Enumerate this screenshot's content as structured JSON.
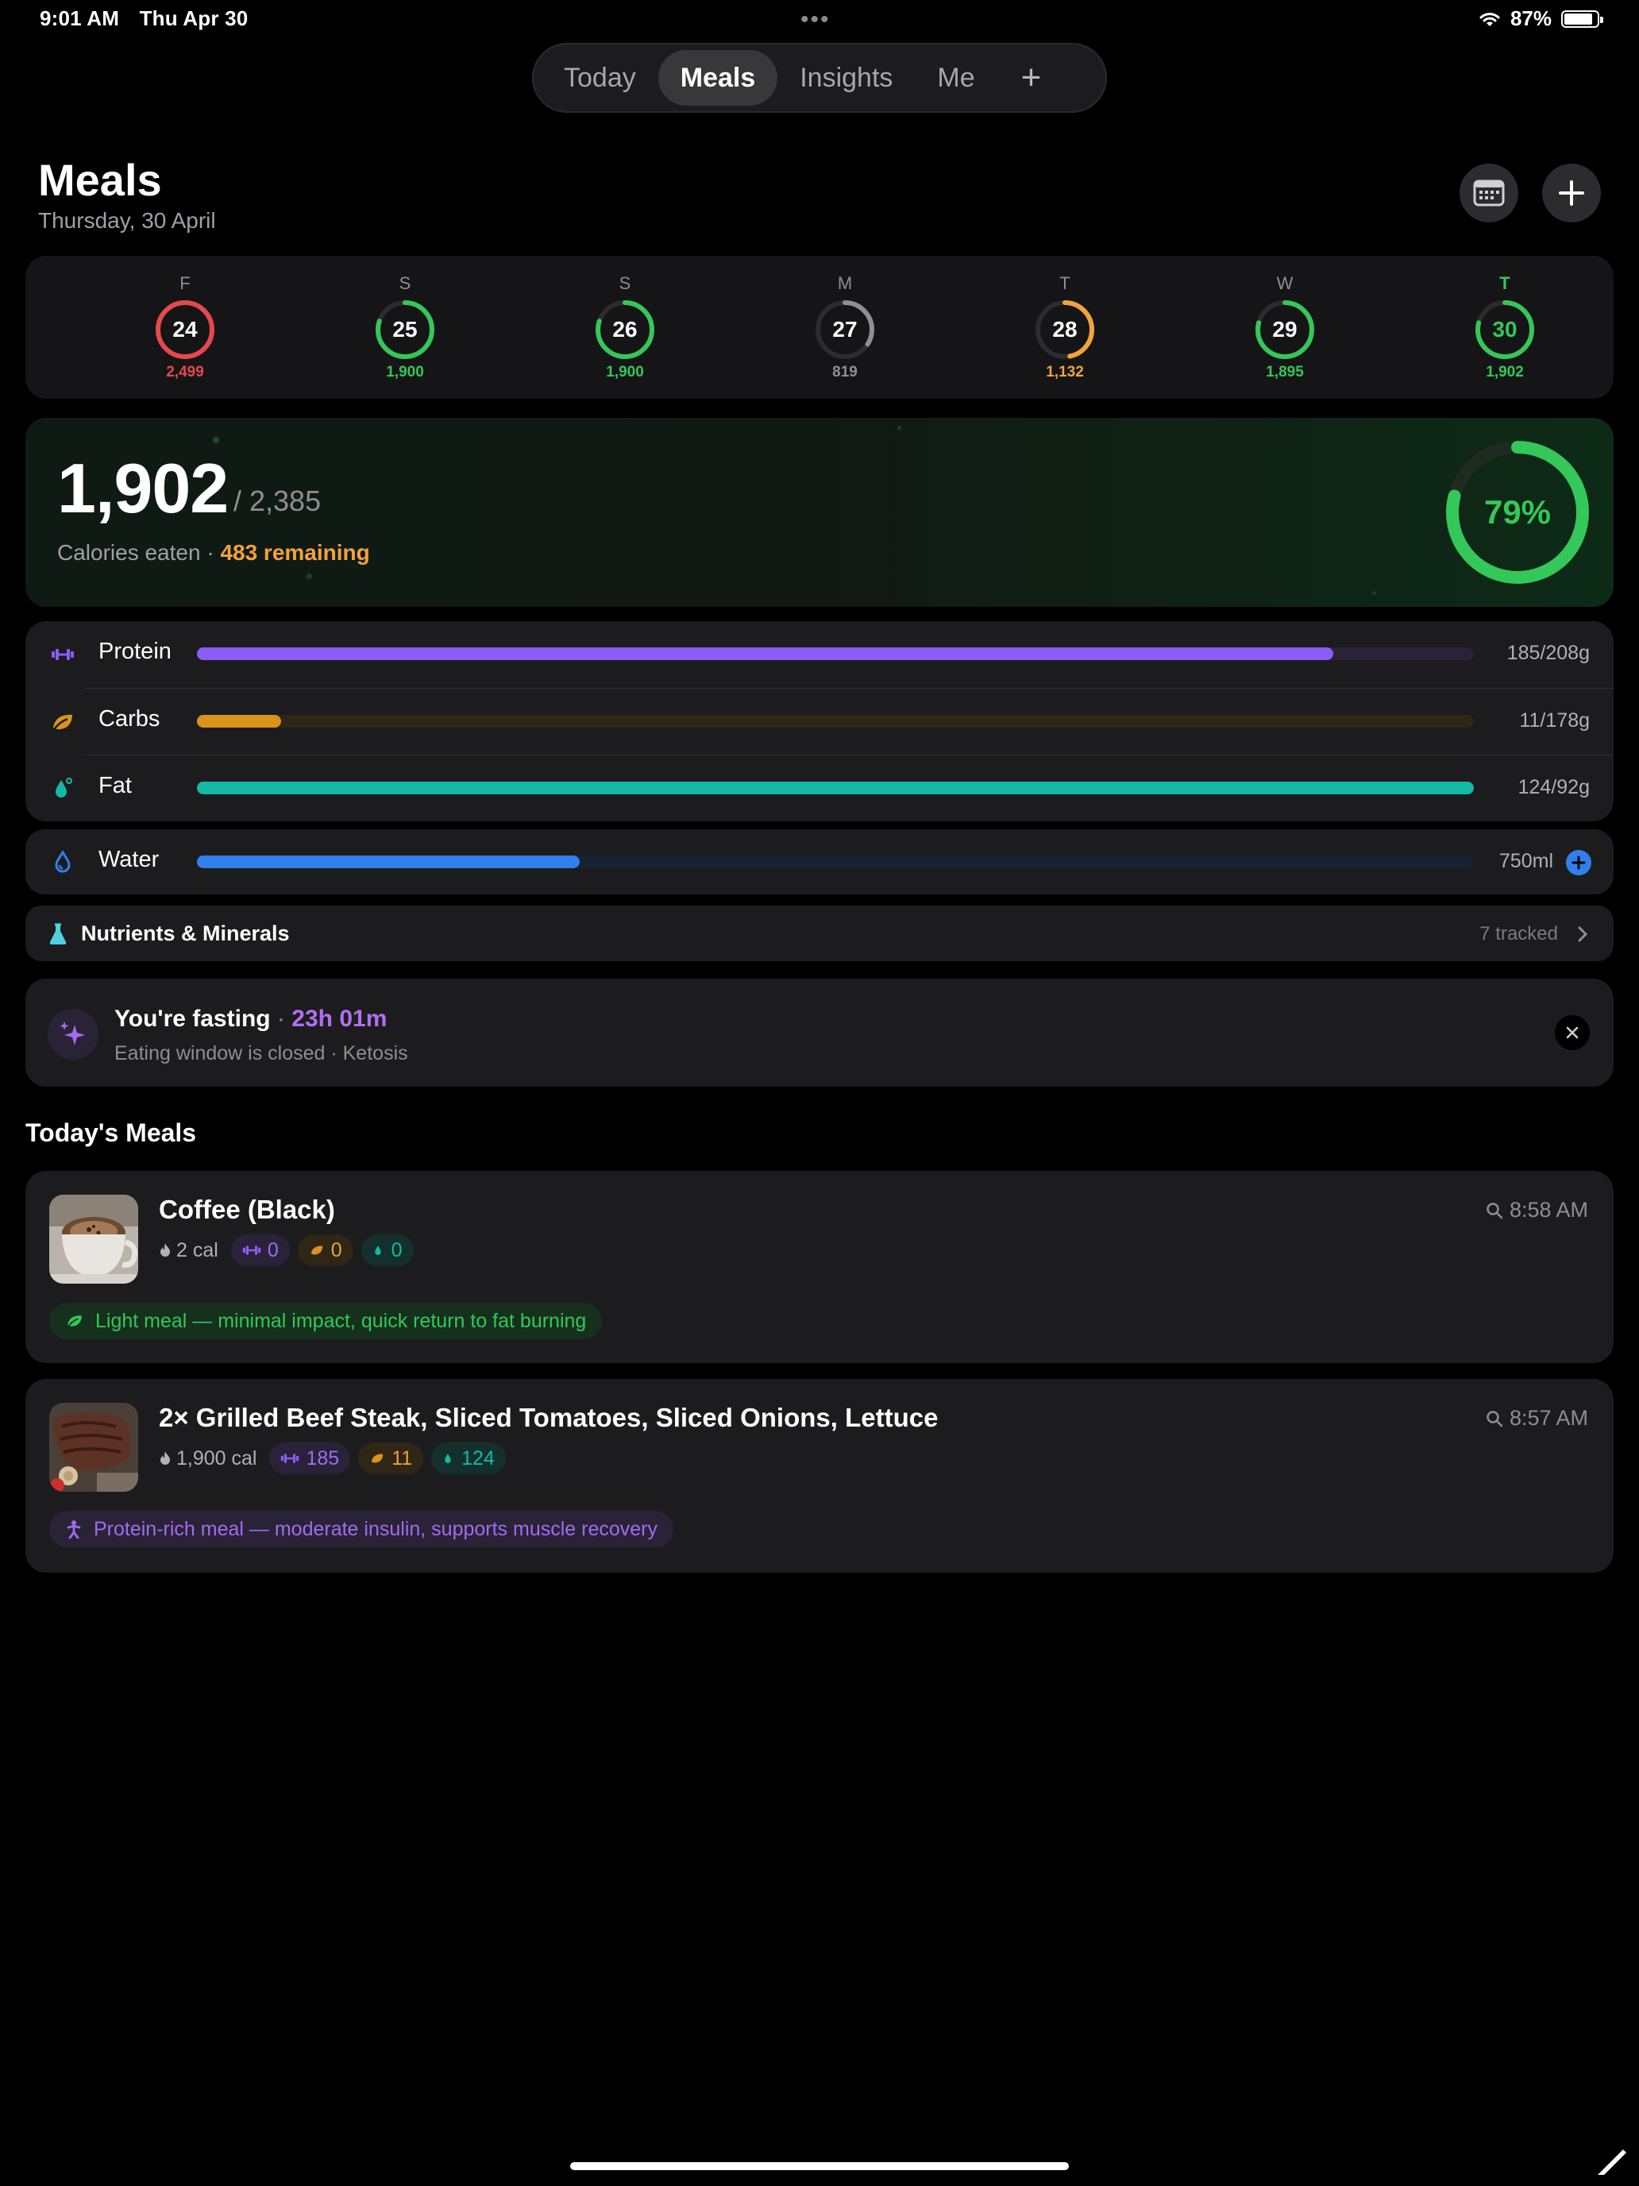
{
  "status": {
    "time": "9:01 AM",
    "date": "Thu Apr 30",
    "battery": "87%",
    "battery_level": 0.87
  },
  "tabs": [
    {
      "label": "Today"
    },
    {
      "label": "Meals",
      "active": true
    },
    {
      "label": "Insights"
    },
    {
      "label": "Me"
    },
    {
      "label": "+"
    }
  ],
  "header": {
    "title": "Meals",
    "subtitle": "Thursday, 30 April"
  },
  "week": [
    {
      "letter": "F",
      "day": "24",
      "cal": "2,499",
      "color": "#e5484d",
      "progress": 1.0
    },
    {
      "letter": "S",
      "day": "25",
      "cal": "1,900",
      "color": "#34c759",
      "progress": 0.8
    },
    {
      "letter": "S",
      "day": "26",
      "cal": "1,900",
      "color": "#34c759",
      "progress": 0.8
    },
    {
      "letter": "M",
      "day": "27",
      "cal": "819",
      "color": "#8e8e93",
      "progress": 0.34
    },
    {
      "letter": "T",
      "day": "28",
      "cal": "1,132",
      "color": "#f2a33a",
      "progress": 0.47
    },
    {
      "letter": "W",
      "day": "29",
      "cal": "1,895",
      "color": "#34c759",
      "progress": 0.79
    },
    {
      "letter": "T",
      "day": "30",
      "cal": "1,902",
      "color": "#34c759",
      "progress": 0.79,
      "today": true
    }
  ],
  "calories": {
    "eaten": "1,902",
    "goal": "/ 2,385",
    "label": "Calories eaten ·",
    "remaining": "483 remaining",
    "percent": "79%",
    "progress": 0.79
  },
  "macros": [
    {
      "name": "Protein",
      "value": "185/208g",
      "progress": 0.89,
      "color": "#8b5cf6",
      "track": "#2a2238",
      "icon": "dumbbell-icon"
    },
    {
      "name": "Carbs",
      "value": "11/178g",
      "progress": 0.066,
      "color": "#d9931a",
      "track": "#2f2616",
      "icon": "leaf-icon"
    },
    {
      "name": "Fat",
      "value": "124/92g",
      "progress": 1.0,
      "color": "#14b8a6",
      "track": "#13302c",
      "icon": "drop-icon"
    }
  ],
  "water": {
    "name": "Water",
    "value": "750ml",
    "progress": 0.3,
    "color": "#2f80ed",
    "track": "#172233"
  },
  "nutrients": {
    "label": "Nutrients & Minerals",
    "tracked": "7 tracked"
  },
  "fasting": {
    "title": "You're fasting",
    "dot": "·",
    "duration": "23h 01m",
    "subtitle": "Eating window is closed · Ketosis"
  },
  "section_title": "Today's Meals",
  "meals": [
    {
      "name": "Coffee (Black)",
      "time": "8:58 AM",
      "kcal": "2 cal",
      "protein": "0",
      "carbs": "0",
      "fat": "0",
      "note": "Light meal — minimal impact, quick return to fat burning",
      "note_color": "#34c759",
      "note_bg": "#15301d",
      "note_icon": "leaf-icon"
    },
    {
      "name": "2× Grilled Beef Steak, Sliced Tomatoes, Sliced Onions, Lettuce",
      "time": "8:57 AM",
      "kcal": "1,900 cal",
      "protein": "185",
      "carbs": "11",
      "fat": "124",
      "note": "Protein-rich meal — moderate insulin, supports muscle recovery",
      "note_color": "#a06cf0",
      "note_bg": "#2a2236",
      "note_icon": "figure-icon"
    }
  ]
}
